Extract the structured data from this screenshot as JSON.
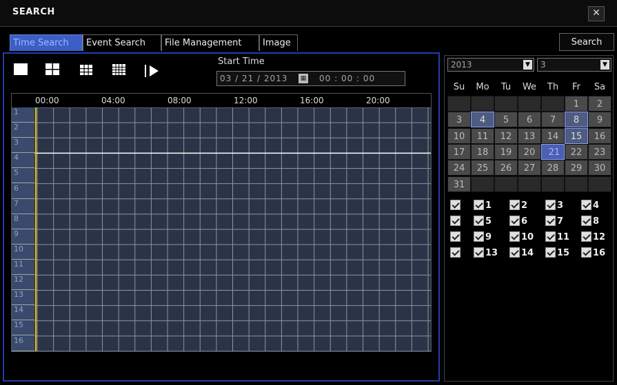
{
  "window": {
    "title": "SEARCH",
    "close_icon": "close-icon"
  },
  "tabs": [
    {
      "label": "Time Search",
      "active": true
    },
    {
      "label": "Event Search",
      "active": false
    },
    {
      "label": "File Management",
      "active": false
    },
    {
      "label": "Image",
      "active": false
    }
  ],
  "search_button": "Search",
  "layout_buttons": [
    "single-view-icon",
    "quad-view-icon",
    "nine-view-icon",
    "sixteen-view-icon",
    "play-icon"
  ],
  "start_time": {
    "label": "Start Time",
    "date": "03 / 21 / 2013",
    "time": "00 : 00 : 00"
  },
  "timeline": {
    "hours": [
      "00:00",
      "04:00",
      "08:00",
      "12:00",
      "16:00",
      "20:00"
    ],
    "channels": [
      "1",
      "2",
      "3",
      "4",
      "5",
      "6",
      "7",
      "8",
      "9",
      "10",
      "11",
      "12",
      "13",
      "14",
      "15",
      "16"
    ]
  },
  "calendar": {
    "year": "2013",
    "month": "3",
    "weekdays": [
      "Su",
      "Mo",
      "Tu",
      "We",
      "Th",
      "Fr",
      "Sa"
    ],
    "first_weekday": 5,
    "days_in_month": 31,
    "recorded_days": [
      4,
      8,
      15
    ],
    "selected_day": 21
  },
  "channel_checks": [
    {
      "label": "",
      "checked": true
    },
    {
      "label": "1",
      "checked": true
    },
    {
      "label": "2",
      "checked": true
    },
    {
      "label": "3",
      "checked": true
    },
    {
      "label": "4",
      "checked": true
    },
    {
      "label": "",
      "checked": true
    },
    {
      "label": "5",
      "checked": true
    },
    {
      "label": "6",
      "checked": true
    },
    {
      "label": "7",
      "checked": true
    },
    {
      "label": "8",
      "checked": true
    },
    {
      "label": "",
      "checked": true
    },
    {
      "label": "9",
      "checked": true
    },
    {
      "label": "10",
      "checked": true
    },
    {
      "label": "11",
      "checked": true
    },
    {
      "label": "12",
      "checked": true
    },
    {
      "label": "",
      "checked": true
    },
    {
      "label": "13",
      "checked": true
    },
    {
      "label": "14",
      "checked": true
    },
    {
      "label": "15",
      "checked": true
    },
    {
      "label": "16",
      "checked": true
    }
  ],
  "colors": {
    "accent": "#3b5fc6",
    "grid_bg": "#2a3446",
    "cursor": "#e0c000"
  }
}
